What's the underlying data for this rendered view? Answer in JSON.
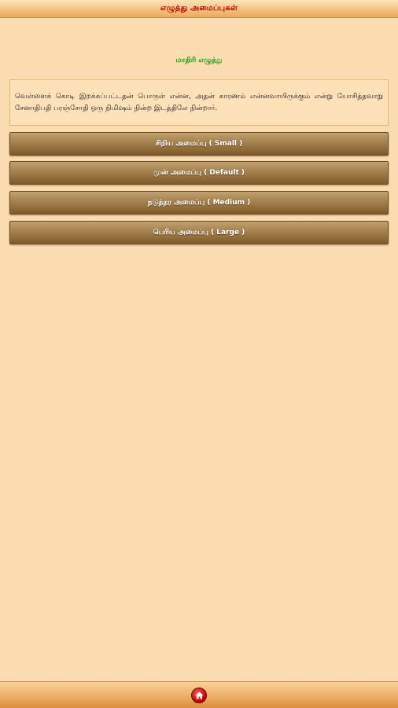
{
  "header": {
    "title": "எழுத்து அமைப்புகள்"
  },
  "sample": {
    "heading": "மாதிரி எழுத்து",
    "text": "வெள்ளைக் கொடி இறக்கப்பட்டதன் பொருள் என்ன, அதன் காரணம் என்னவாயிருக்கும் என்று யோசித்தவாறு சேனாதிபதி பரஞ்சோதி ஒரு நிமிஷம் நின்ற இடத்திலே நின்றார்."
  },
  "sizes": [
    {
      "label": "சிறிய அமைப்பு ( Small )"
    },
    {
      "label": "முன் அமைப்பு ( Default )"
    },
    {
      "label": "நடுத்தர அமைப்பு ( Medium )"
    },
    {
      "label": "பெரிய அமைப்பு ( Large )"
    }
  ],
  "footer": {
    "home_icon": "home-icon"
  },
  "colors": {
    "background": "#fbdcb0",
    "title_text": "#b00000",
    "sample_heading": "#1aa31a",
    "button_top": "#c0a170",
    "button_bottom": "#7f5a28"
  }
}
